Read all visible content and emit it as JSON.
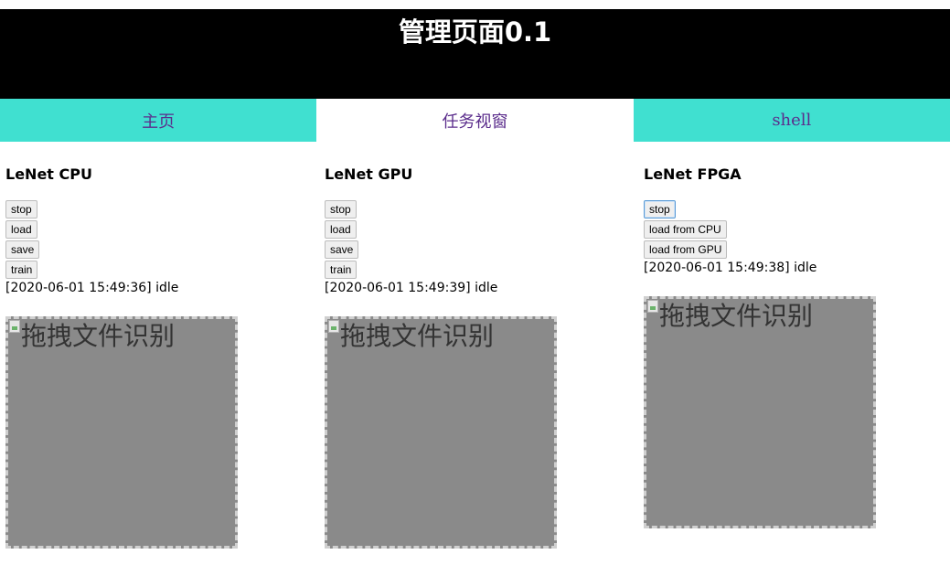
{
  "header": {
    "title": "管理页面0.1"
  },
  "nav": {
    "tabs": [
      {
        "label": "主页"
      },
      {
        "label": "任务视窗"
      },
      {
        "label": "shell"
      }
    ]
  },
  "columns": [
    {
      "title": "LeNet CPU",
      "buttons": [
        "stop",
        "load",
        "save",
        "train"
      ],
      "status": "[2020-06-01 15:49:36] idle",
      "drop_label": "拖拽文件识别"
    },
    {
      "title": "LeNet GPU",
      "buttons": [
        "stop",
        "load",
        "save",
        "train"
      ],
      "status": "[2020-06-01 15:49:39] idle",
      "drop_label": "拖拽文件识别"
    },
    {
      "title": "LeNet FPGA",
      "buttons": [
        "stop",
        "load from CPU",
        "load from GPU"
      ],
      "status": "[2020-06-01 15:49:38] idle",
      "drop_label": "拖拽文件识别"
    }
  ],
  "colors": {
    "header_bg": "#000000",
    "nav_teal": "#40e0d0",
    "nav_text": "#5b2d8c",
    "drop_bg": "#8a8a8a"
  }
}
